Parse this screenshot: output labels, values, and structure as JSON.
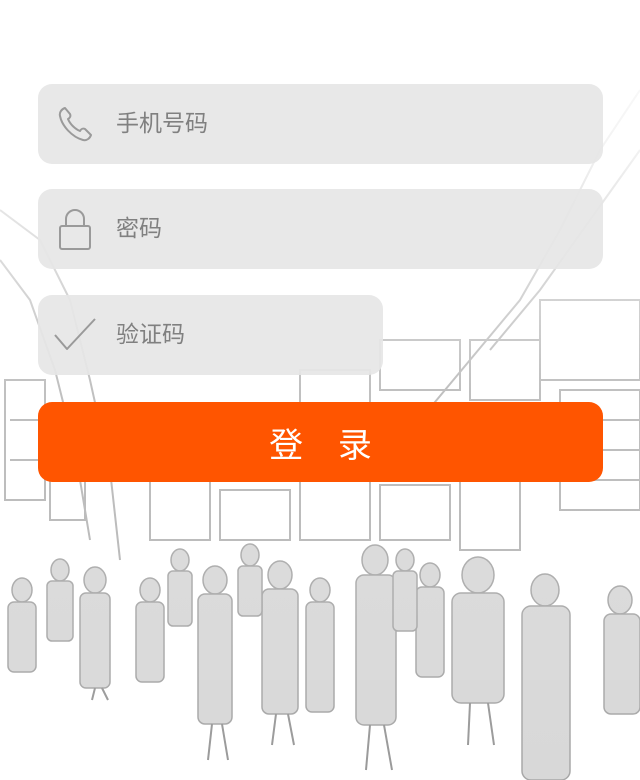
{
  "form": {
    "phone": {
      "placeholder": "手机号码",
      "value": ""
    },
    "password": {
      "placeholder": "密码",
      "value": ""
    },
    "captcha": {
      "placeholder": "验证码",
      "value": ""
    },
    "login_label": "登 录"
  },
  "colors": {
    "accent": "#ff5500",
    "field_bg": "#e6e6e6",
    "placeholder": "#808080",
    "icon": "#9a9a9a"
  },
  "icons": {
    "phone": "phone-icon",
    "password": "lock-icon",
    "captcha": "checkmark-icon"
  }
}
